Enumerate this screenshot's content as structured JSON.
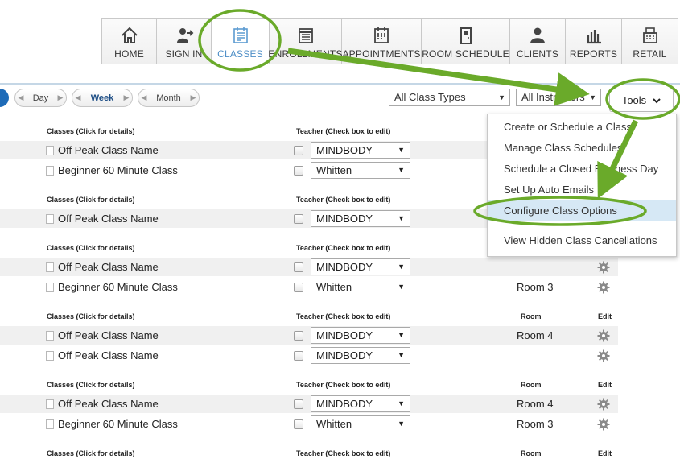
{
  "nav": {
    "tabs": [
      {
        "label": "HOME",
        "icon": "home-icon"
      },
      {
        "label": "SIGN IN",
        "icon": "sign-in-icon"
      },
      {
        "label": "CLASSES",
        "icon": "classes-icon",
        "active": true
      },
      {
        "label": "ENROLLMENTS",
        "icon": "enrollments-icon"
      },
      {
        "label": "APPOINTMENTS",
        "icon": "appointments-icon"
      },
      {
        "label": "ROOM SCHEDULE",
        "icon": "room-schedule-icon"
      },
      {
        "label": "CLIENTS",
        "icon": "clients-icon"
      },
      {
        "label": "REPORTS",
        "icon": "reports-icon"
      },
      {
        "label": "RETAIL",
        "icon": "retail-icon"
      }
    ]
  },
  "toolbar": {
    "day": "Day",
    "week": "Week",
    "month": "Month",
    "class_types": "All Class Types",
    "instructors": "All Instructors",
    "tools": "Tools"
  },
  "headers": {
    "classes": "Classes (Click for details)",
    "teacher": "Teacher (Check box to edit)",
    "room": "Room",
    "edit": "Edit"
  },
  "groups": [
    {
      "rows": [
        {
          "name": "Off Peak Class Name",
          "teacher": "MINDBODY",
          "room": ""
        },
        {
          "name": "Beginner 60 Minute Class",
          "teacher": "Whitten",
          "room": ""
        }
      ]
    },
    {
      "rows": [
        {
          "name": "Off Peak Class Name",
          "teacher": "MINDBODY",
          "room": ""
        }
      ]
    },
    {
      "rows": [
        {
          "name": "Off Peak Class Name",
          "teacher": "MINDBODY",
          "room": ""
        },
        {
          "name": "Beginner 60 Minute Class",
          "teacher": "Whitten",
          "room": "Room 3"
        }
      ]
    },
    {
      "rows": [
        {
          "name": "Off Peak Class Name",
          "teacher": "MINDBODY",
          "room": "Room 4"
        },
        {
          "name": "Off Peak Class Name",
          "teacher": "MINDBODY",
          "room": ""
        }
      ]
    },
    {
      "rows": [
        {
          "name": "Off Peak Class Name",
          "teacher": "MINDBODY",
          "room": "Room 4"
        },
        {
          "name": "Beginner 60 Minute Class",
          "teacher": "Whitten",
          "room": "Room 3"
        }
      ]
    },
    {
      "rows": []
    }
  ],
  "tools_menu": {
    "items": [
      "Create or Schedule a Class",
      "Manage Class Schedules",
      "Schedule a Closed Business Day",
      "Set Up Auto Emails",
      "Configure Class Options",
      "View Hidden Class Cancellations"
    ],
    "highlighted_index": 4
  },
  "colors": {
    "accent_blue": "#1e6bb8",
    "annotation_green": "#6aaa2a",
    "menu_highlight": "#d6e8f5"
  }
}
